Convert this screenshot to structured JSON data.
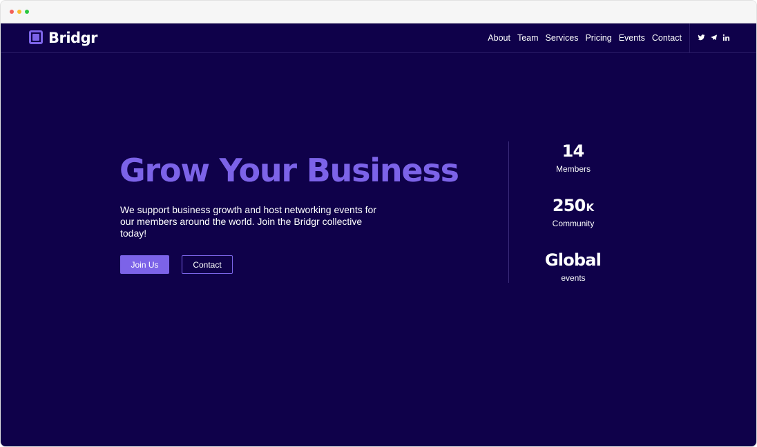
{
  "brand": {
    "name": "Bridgr",
    "accent": "#7c63e8",
    "background": "#0f014a"
  },
  "nav": {
    "links": [
      "About",
      "Team",
      "Services",
      "Pricing",
      "Events",
      "Contact"
    ],
    "social": [
      "twitter-icon",
      "telegram-icon",
      "linkedin-icon"
    ]
  },
  "hero": {
    "title": "Grow Your Business",
    "text": "We support business growth and host networking events for our members around the world. Join the Bridgr collective today!",
    "join_label": "Join Us",
    "contact_label": "Contact"
  },
  "stats": [
    {
      "value": "14",
      "suffix": "",
      "label": "Members"
    },
    {
      "value": "250",
      "suffix": "K",
      "label": "Community"
    },
    {
      "value": "Global",
      "suffix": "",
      "label": "events"
    }
  ]
}
